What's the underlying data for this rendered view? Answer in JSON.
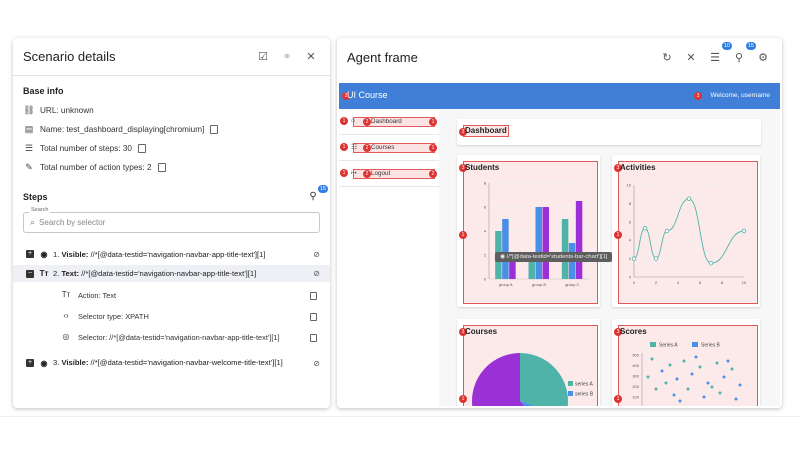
{
  "left_panel": {
    "title": "Scenario details",
    "base_info_heading": "Base info",
    "url_text": "URL: unknown",
    "name_text": "Name: test_dashboard_displaying[chromium]",
    "total_steps_text": "Total number of steps: 30",
    "total_action_types_text": "Total number of action types: 2",
    "steps_heading": "Steps",
    "steps_badge": "15",
    "search_label": "Search",
    "search_placeholder": "Search by selector",
    "steps": [
      {
        "number": "1.",
        "action": "Visible",
        "selector": "//*[@data-testid='navigation-navbar-app-title-text'][1]"
      },
      {
        "number": "2.",
        "action": "Text",
        "selector": "//*[@data-testid='navigation-navbar-app-title-text'][1]"
      },
      {
        "number": "3.",
        "action": "Visible",
        "selector": "//*[@data-testid='navigation-navbar-welcome-title-text'][1]"
      }
    ],
    "step2_details": {
      "action_text": "Action: Text",
      "selector_type_text": "Selector type: XPATH",
      "selector_text": "Selector: //*[@data-testid='navigation-navbar-app-title-text'][1]"
    }
  },
  "right_panel": {
    "title": "Agent frame",
    "badge_a": "10",
    "badge_b": "15"
  },
  "app": {
    "title": "UI Course",
    "welcome": "Welcome, username",
    "nav": [
      {
        "label": "Dashboard",
        "icon": "home-icon"
      },
      {
        "label": "Courses",
        "icon": "list-icon"
      },
      {
        "label": "Logout",
        "icon": "logout-icon"
      }
    ],
    "dashboard_title": "Dashboard",
    "tooltip": "//*[@data-testid='students-bar-chart'][1]",
    "cards": {
      "students": "Students",
      "activities": "Activities",
      "courses": "Courses",
      "scores": "Scores"
    },
    "marker_numbers": [
      "1",
      "2",
      "3"
    ]
  },
  "chart_data": [
    {
      "type": "bar",
      "title": "Students",
      "categories": [
        "group A",
        "group B",
        "group C"
      ],
      "series": [
        {
          "values": [
            4,
            2,
            5
          ],
          "color": "#4fb3a9"
        },
        {
          "values": [
            5,
            6,
            3
          ],
          "color": "#4a8fe7"
        },
        {
          "values": [
            2,
            6,
            6.5
          ],
          "color": "#9b30d6"
        }
      ],
      "ylim": [
        0,
        8
      ],
      "yticks": [
        "0",
        "2",
        "4",
        "6",
        "8"
      ]
    },
    {
      "type": "line",
      "title": "Activities",
      "x": [
        0,
        1,
        2,
        3,
        5,
        7,
        10
      ],
      "y": [
        2,
        5.3,
        2,
        5,
        8.5,
        1.5,
        5
      ],
      "xlim": [
        0,
        10
      ],
      "ylim": [
        0,
        10
      ],
      "xticks": [
        "0",
        "2",
        "4",
        "6",
        "8",
        "10"
      ],
      "yticks": [
        "0",
        "2",
        "4",
        "6",
        "8",
        "10"
      ],
      "color": "#4fb3a9"
    },
    {
      "type": "pie",
      "title": "Courses",
      "labels": [
        "series A",
        "series B",
        ""
      ],
      "colors": [
        "#4fb3a9",
        "#4a8fe7",
        "#9b30d6"
      ]
    },
    {
      "type": "scatter",
      "title": "Scores",
      "series": [
        {
          "name": "Series A",
          "color": "#4fb3a9"
        },
        {
          "name": "Series B",
          "color": "#4a8fe7"
        }
      ],
      "yticks": [
        "500",
        "400",
        "300",
        "200",
        "100"
      ]
    }
  ]
}
